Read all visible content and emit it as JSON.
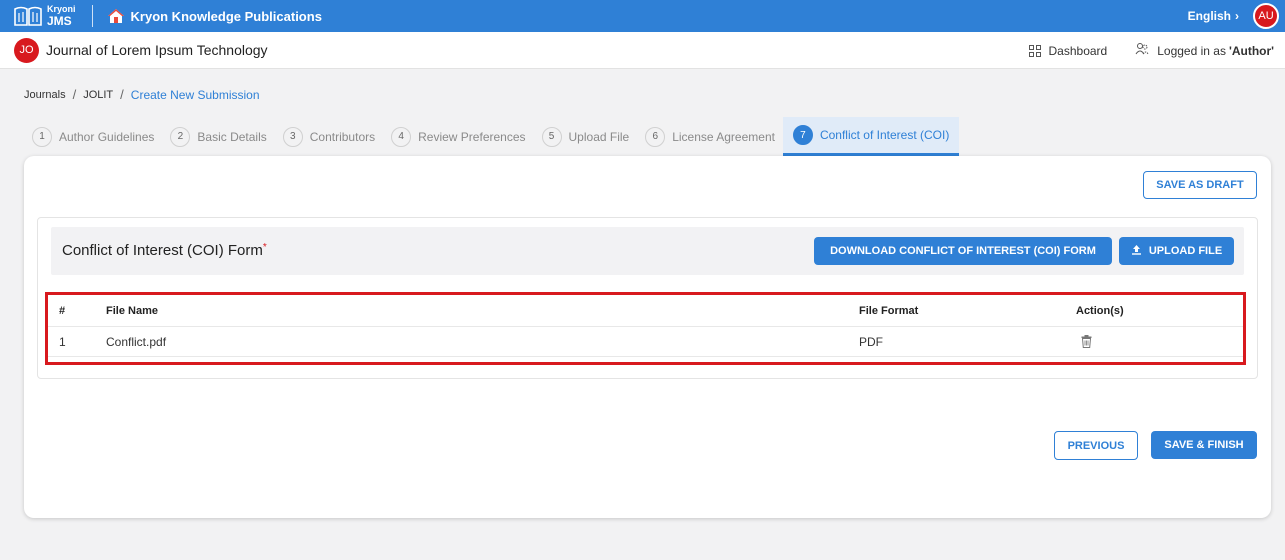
{
  "header": {
    "logo_line1": "Kryoni",
    "logo_line2": "JMS",
    "publisher": "Kryon Knowledge Publications",
    "language": "English",
    "language_chevron": "›",
    "user_initials": "AU"
  },
  "subheader": {
    "journal_initials": "JO",
    "journal_title": "Journal of Lorem Ipsum Technology",
    "dashboard_label": "Dashboard",
    "logged_prefix": "Logged in as",
    "logged_role": "'Author'"
  },
  "breadcrumb": {
    "items": [
      "Journals",
      "JOLIT",
      "Create New Submission"
    ],
    "separator": "/"
  },
  "steps": [
    {
      "num": "1",
      "label": "Author Guidelines"
    },
    {
      "num": "2",
      "label": "Basic Details"
    },
    {
      "num": "3",
      "label": "Contributors"
    },
    {
      "num": "4",
      "label": "Review Preferences"
    },
    {
      "num": "5",
      "label": "Upload File"
    },
    {
      "num": "6",
      "label": "License Agreement"
    },
    {
      "num": "7",
      "label": "Conflict of Interest (COI)"
    }
  ],
  "active_step": "7",
  "actions": {
    "save_draft": "SAVE AS DRAFT",
    "previous": "PREVIOUS",
    "save_finish": "SAVE & FINISH"
  },
  "coi": {
    "title": "Conflict of Interest (COI) Form",
    "required_mark": "*",
    "download_label": "DOWNLOAD CONFLICT OF INTEREST (COI) FORM",
    "upload_label": "UPLOAD FILE"
  },
  "table": {
    "headers": [
      "#",
      "File Name",
      "File Format",
      "Action(s)"
    ],
    "rows": [
      {
        "index": "1",
        "file_name": "Conflict.pdf",
        "format": "PDF",
        "action_icon": "trash-icon"
      }
    ]
  },
  "colors": {
    "primary": "#2f80d6",
    "danger": "#d8191e",
    "page_bg": "#f2f2f3"
  }
}
